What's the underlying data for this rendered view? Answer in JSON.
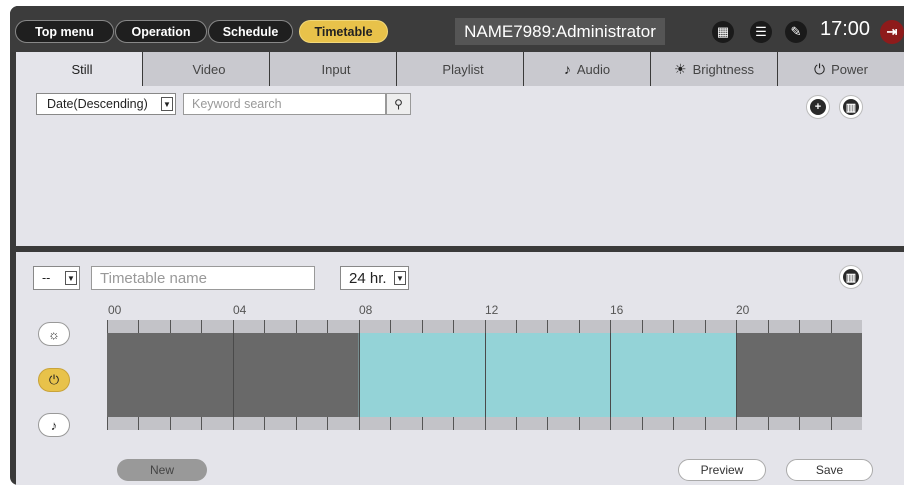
{
  "topbar": {
    "nav": [
      "Top menu",
      "Operation",
      "Schedule",
      "Timetable"
    ],
    "account": "NAME7989:Administrator",
    "time": "17:00",
    "icons": [
      "calendar-icon",
      "list-icon",
      "wrench-icon",
      "exit-icon"
    ]
  },
  "tabs": [
    {
      "label": "Still",
      "icon": ""
    },
    {
      "label": "Video",
      "icon": ""
    },
    {
      "label": "Input",
      "icon": ""
    },
    {
      "label": "Playlist",
      "icon": ""
    },
    {
      "label": "Audio",
      "icon": "♪"
    },
    {
      "label": "Brightness",
      "icon": "☀"
    },
    {
      "label": "Power",
      "icon": "⏻"
    }
  ],
  "library": {
    "sort": "Date(Descending)",
    "search_placeholder": "Keyword search"
  },
  "timetable": {
    "select": "--",
    "name_placeholder": "Timetable name",
    "hour_format": "24 hr.",
    "ticks": [
      "00",
      "04",
      "08",
      "12",
      "16",
      "20"
    ],
    "power_on_range": [
      8,
      20
    ],
    "buttons": {
      "new": "New",
      "preview": "Preview",
      "save": "Save"
    }
  },
  "colors": {
    "accent": "#e8c24a",
    "power_on": "#94d3d7",
    "power_off": "#696969"
  }
}
